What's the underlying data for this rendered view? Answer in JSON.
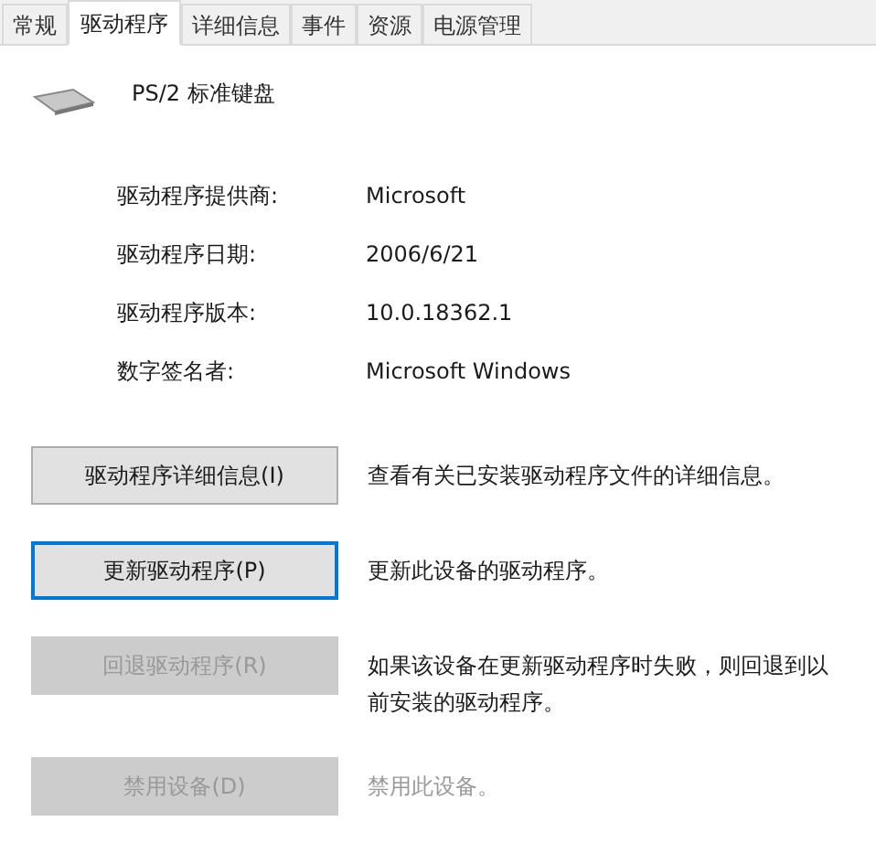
{
  "tabs": [
    {
      "label": "常规",
      "selected": false
    },
    {
      "label": "驱动程序",
      "selected": true
    },
    {
      "label": "详细信息",
      "selected": false
    },
    {
      "label": "事件",
      "selected": false
    },
    {
      "label": "资源",
      "selected": false
    },
    {
      "label": "电源管理",
      "selected": false
    }
  ],
  "device": {
    "name": "PS/2 标准键盘"
  },
  "properties": [
    {
      "label": "驱动程序提供商:",
      "value": "Microsoft"
    },
    {
      "label": "驱动程序日期:",
      "value": "2006/6/21"
    },
    {
      "label": "驱动程序版本:",
      "value": "10.0.18362.1"
    },
    {
      "label": "数字签名者:",
      "value": "Microsoft Windows"
    }
  ],
  "actions": [
    {
      "button": "驱动程序详细信息(I)",
      "disabled": false,
      "focused": false,
      "description": "查看有关已安装驱动程序文件的详细信息。",
      "description_disabled": false
    },
    {
      "button": "更新驱动程序(P)",
      "disabled": false,
      "focused": true,
      "description": "更新此设备的驱动程序。",
      "description_disabled": false
    },
    {
      "button": "回退驱动程序(R)",
      "disabled": true,
      "focused": false,
      "description": "如果该设备在更新驱动程序时失败，则回退到以前安装的驱动程序。",
      "description_disabled": false
    },
    {
      "button": "禁用设备(D)",
      "disabled": true,
      "focused": false,
      "description": "禁用此设备。",
      "description_disabled": true
    }
  ]
}
